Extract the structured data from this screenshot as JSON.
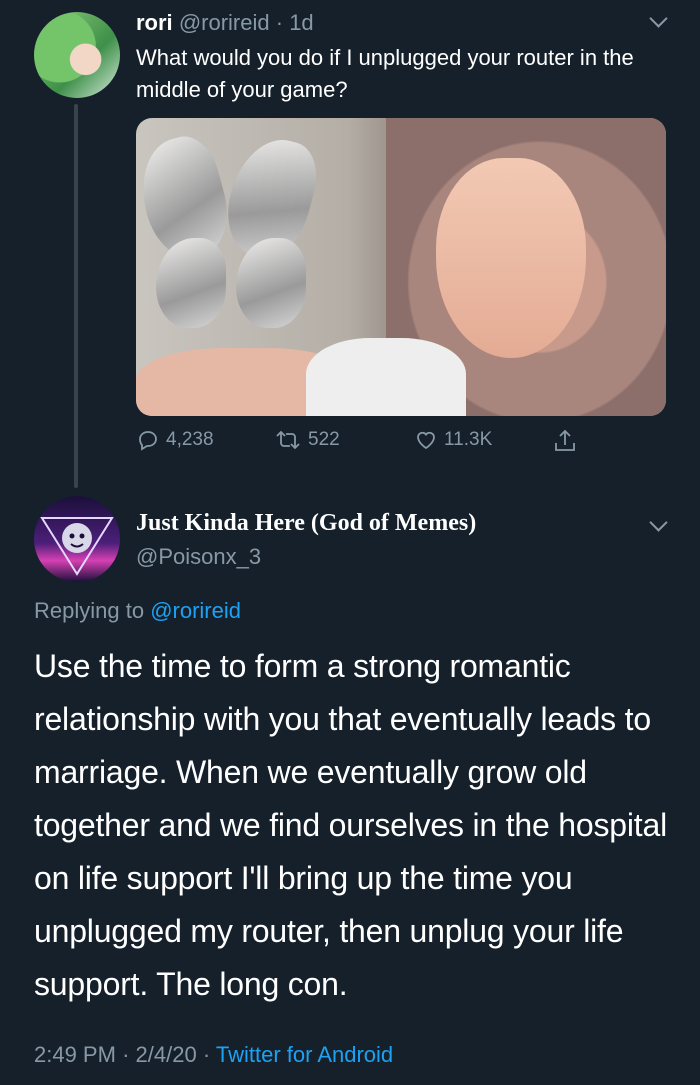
{
  "tweet": {
    "name": "rori",
    "handle": "@rorireid",
    "separator": "·",
    "time": "1d",
    "text": "What would you do if I unplugged your router in the middle of your game?",
    "photo_icon": "photo-of-woman",
    "stats": {
      "replies": "4,238",
      "retweets": "522",
      "likes": "11.3K"
    },
    "icons": {
      "reply": "reply-icon",
      "retweet": "retweet-icon",
      "like": "heart-icon",
      "share": "share-icon",
      "menu": "chevron-down-icon"
    }
  },
  "reply": {
    "name": "Just Kinda Here (God of Memes)",
    "handle": "@Poisonx_3",
    "replying_prefix": "Replying to",
    "replying_to": "@rorireid",
    "text": "Use the time to form a strong romantic relationship with you that eventually leads to marriage. When we eventually grow old together and we find ourselves in the hospital on life support I'll bring up the time you unplugged my router, then unplug your life support. The long con.",
    "time": "2:49 PM",
    "separator": "·",
    "date": "2/4/20",
    "separator2": "·",
    "client": "Twitter for Android"
  },
  "colors": {
    "background": "#15202b",
    "muted": "#8899a6",
    "link": "#1da1f2",
    "text": "#ffffff"
  }
}
